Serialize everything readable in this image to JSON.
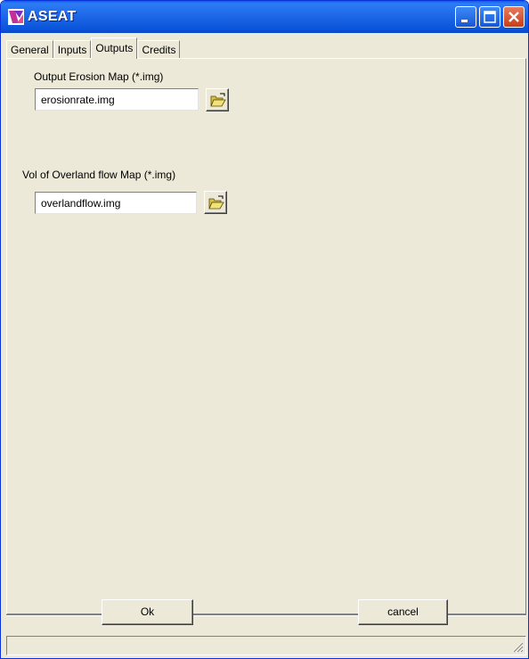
{
  "window": {
    "title": "ASEAT",
    "app_icon": "aseat-logo-icon",
    "controls": [
      "minimize-icon",
      "maximize-icon",
      "close-icon"
    ]
  },
  "tabs": [
    {
      "label": "General",
      "active": false
    },
    {
      "label": "Inputs",
      "active": false
    },
    {
      "label": "Outputs",
      "active": true
    },
    {
      "label": "Credits",
      "active": false
    }
  ],
  "outputs": {
    "erosion_map": {
      "label": "Output Erosion Map (*.img)",
      "value": "erosionrate.img",
      "browse_icon": "open-folder-icon"
    },
    "overland_flow_map": {
      "label": "Vol of Overland flow Map (*.img)",
      "value": "overlandflow.img",
      "browse_icon": "open-folder-icon"
    }
  },
  "buttons": {
    "ok": "Ok",
    "cancel": "cancel"
  },
  "colors": {
    "titlebar": "#0b54d9",
    "face": "#ece9d8",
    "close_button": "#c73e19"
  }
}
